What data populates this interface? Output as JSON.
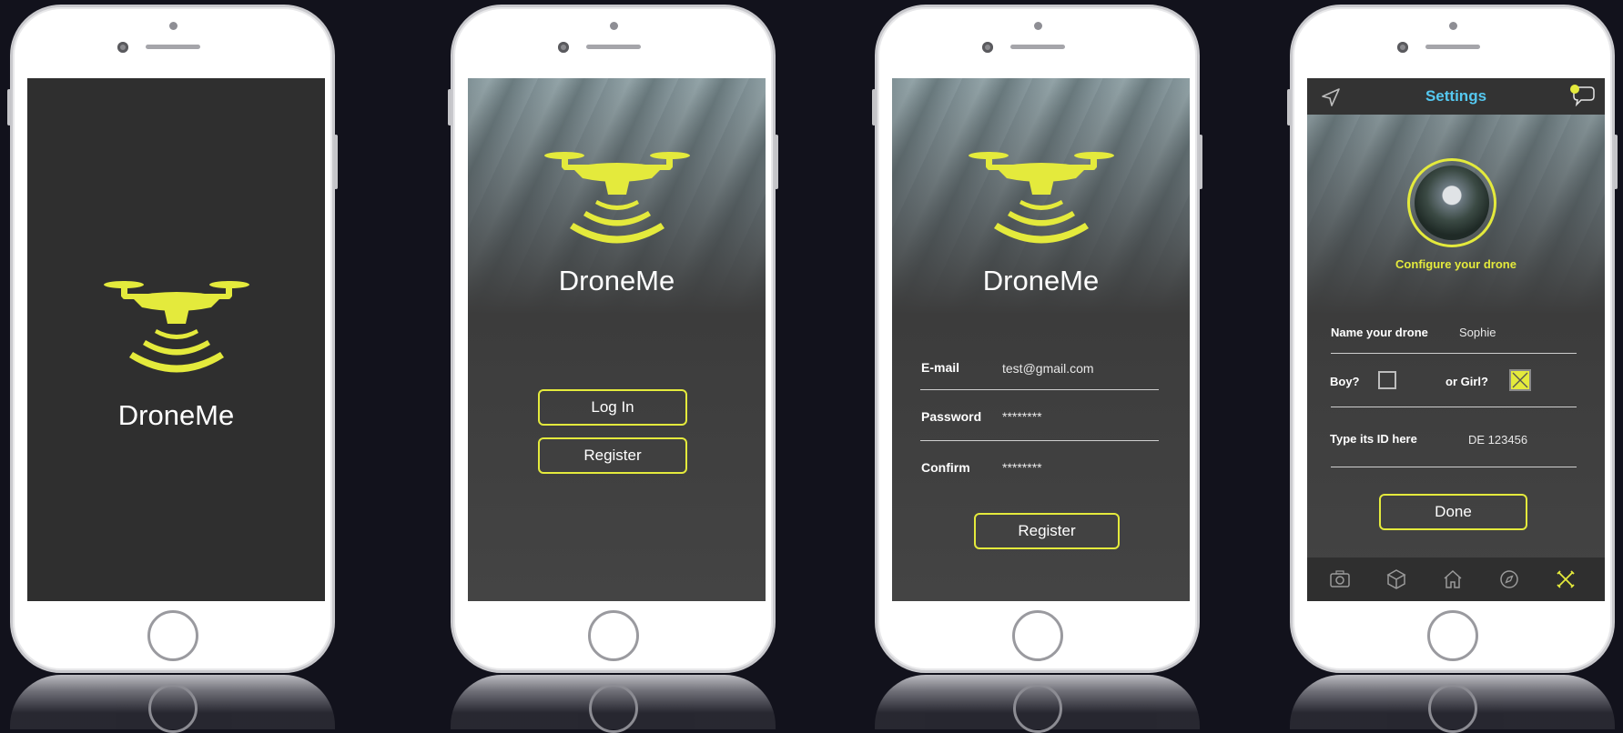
{
  "app_name": "DroneMe",
  "colors": {
    "accent": "#e4ea3c",
    "title_blue": "#55c8f0",
    "screen_bg": "#2f2f2f"
  },
  "splash": {
    "logo_text": "DroneMe"
  },
  "welcome": {
    "logo_text": "DroneMe",
    "login_label": "Log In",
    "register_label": "Register"
  },
  "register": {
    "logo_text": "DroneMe",
    "email_label": "E-mail",
    "email_value": "test@gmail.com",
    "password_label": "Password",
    "password_value": "********",
    "confirm_label": "Confirm",
    "confirm_value": "********",
    "register_label": "Register"
  },
  "settings": {
    "title": "Settings",
    "left_icon": "navigation-arrow-icon",
    "right_icon": "chat-bubble-icon",
    "configure_label": "Configure your drone",
    "name_label": "Name your drone",
    "name_value": "Sophie",
    "boy_label": "Boy?",
    "boy_checked": false,
    "girl_label": "or Girl?",
    "girl_checked": true,
    "id_label": "Type its ID here",
    "id_value": "DE 123456",
    "done_label": "Done",
    "tabs": [
      "camera-icon",
      "box-icon",
      "home-icon",
      "compass-icon",
      "tools-icon"
    ],
    "active_tab": "tools-icon"
  }
}
